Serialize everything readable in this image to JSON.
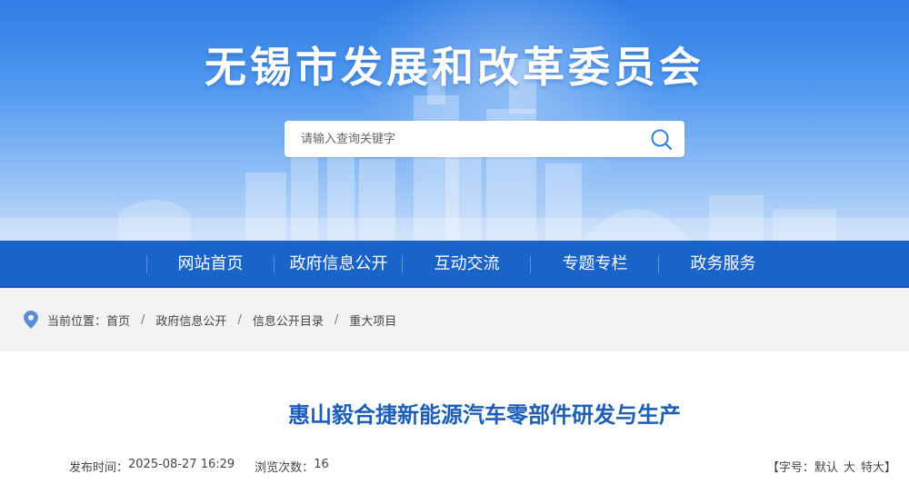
{
  "site": {
    "title": "无锡市发展和改革委员会"
  },
  "search": {
    "placeholder": "请输入查询关键字",
    "button_icon": "search-icon"
  },
  "nav": {
    "items": [
      {
        "label": "网站首页"
      },
      {
        "label": "政府信息公开"
      },
      {
        "label": "互动交流"
      },
      {
        "label": "专题专栏"
      },
      {
        "label": "政务服务"
      }
    ]
  },
  "breadcrumb": {
    "icon": "location-pin-icon",
    "prefix": "当前位置：",
    "items": [
      "首页",
      "政府信息公开",
      "信息公开目录",
      "重大项目"
    ],
    "separator": "/"
  },
  "article": {
    "title": "惠山毅合捷新能源汽车零部件研发与生产",
    "publish_label": "发布时间：",
    "publish_time": "2025-08-27 16:29",
    "views_label": "浏览次数：",
    "views": "16"
  },
  "font_size": {
    "open": "【",
    "label": "字号：",
    "options": [
      "默认",
      "大",
      "特大"
    ],
    "close": "】"
  },
  "colors": {
    "nav_bg": "#1a63c8",
    "title_blue": "#1d5fb8",
    "breadcrumb_bg": "#f3f3f3"
  }
}
